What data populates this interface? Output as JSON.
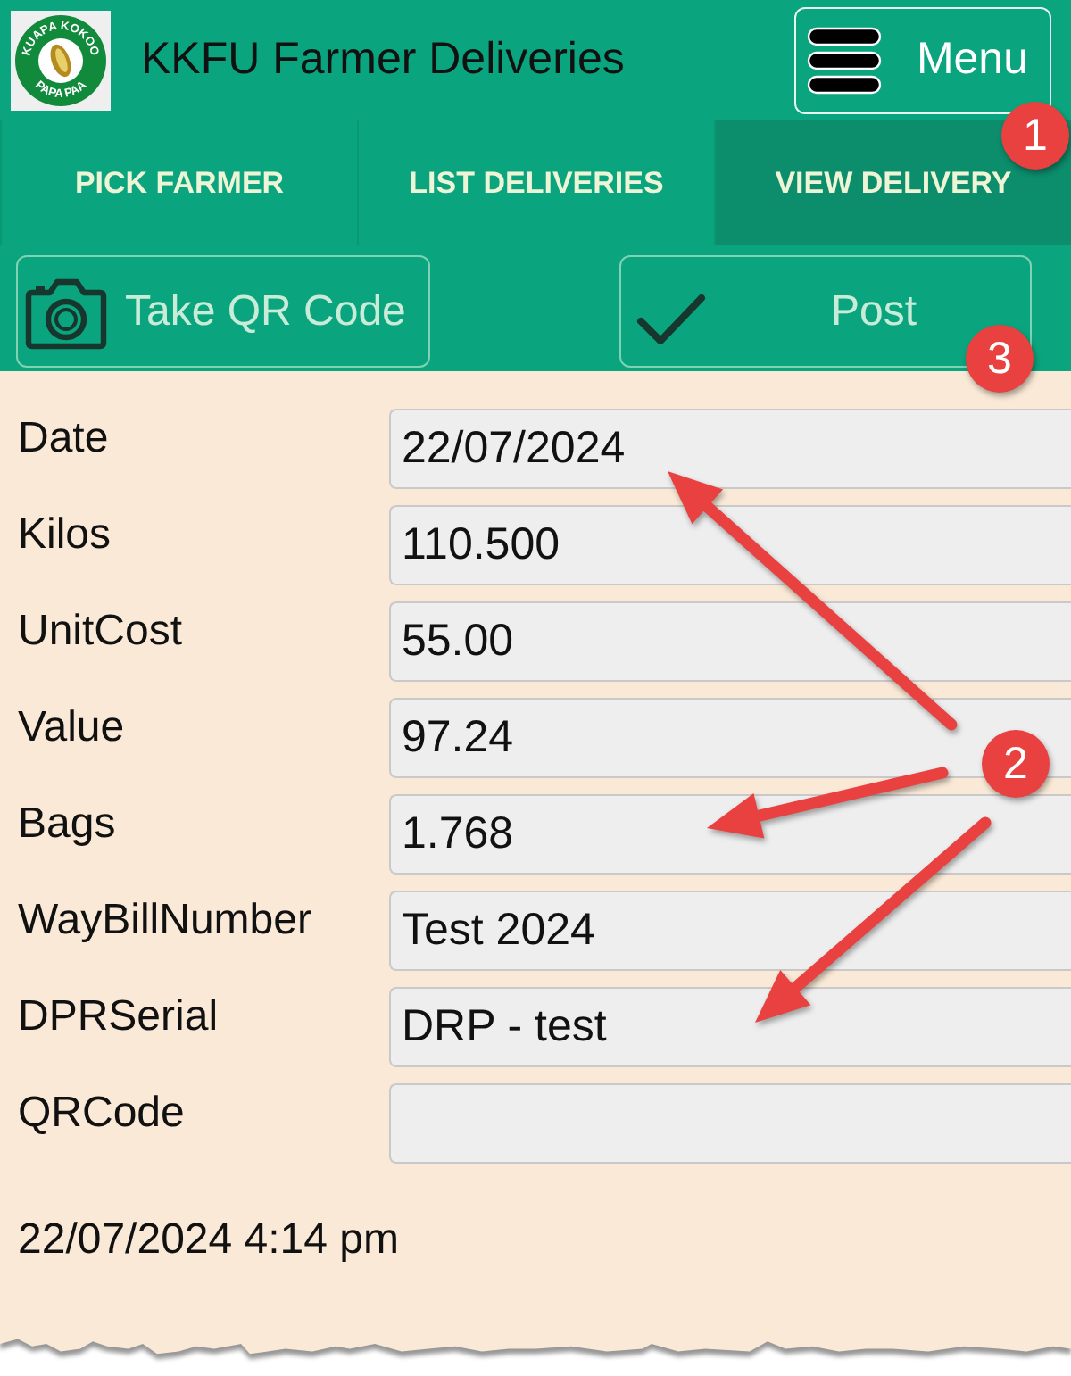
{
  "app_bar": {
    "logo": {
      "top_text": "KUAPA KOKOO",
      "bottom_text": "PAPA PAA"
    },
    "title": "KKFU Farmer Deliveries",
    "menu_button": {
      "label": "Menu"
    }
  },
  "tabs": [
    {
      "label": "PICK FARMER",
      "selected": false
    },
    {
      "label": "LIST DELIVERIES",
      "selected": false
    },
    {
      "label": "VIEW DELIVERY",
      "selected": true
    }
  ],
  "toolbar": {
    "buttons": [
      {
        "kind": "camera",
        "label": "Take QR Code"
      },
      {
        "kind": "check",
        "label": "Post"
      }
    ]
  },
  "form": {
    "fields": [
      {
        "label": "Date",
        "value": "22/07/2024"
      },
      {
        "label": "Kilos",
        "value": "110.500"
      },
      {
        "label": "UnitCost",
        "value": "55.00"
      },
      {
        "label": "Value",
        "value": "97.24"
      },
      {
        "label": "Bags",
        "value": "1.768"
      },
      {
        "label": "WayBillNumber",
        "value": "Test 2024"
      },
      {
        "label": "DPRSerial",
        "value": "DRP - test"
      },
      {
        "label": "QRCode"
      }
    ]
  },
  "timestamp": "22/07/2024 4:14 pm",
  "callouts": [
    {
      "label": "1"
    },
    {
      "label": "3"
    },
    {
      "label": "2"
    }
  ]
}
